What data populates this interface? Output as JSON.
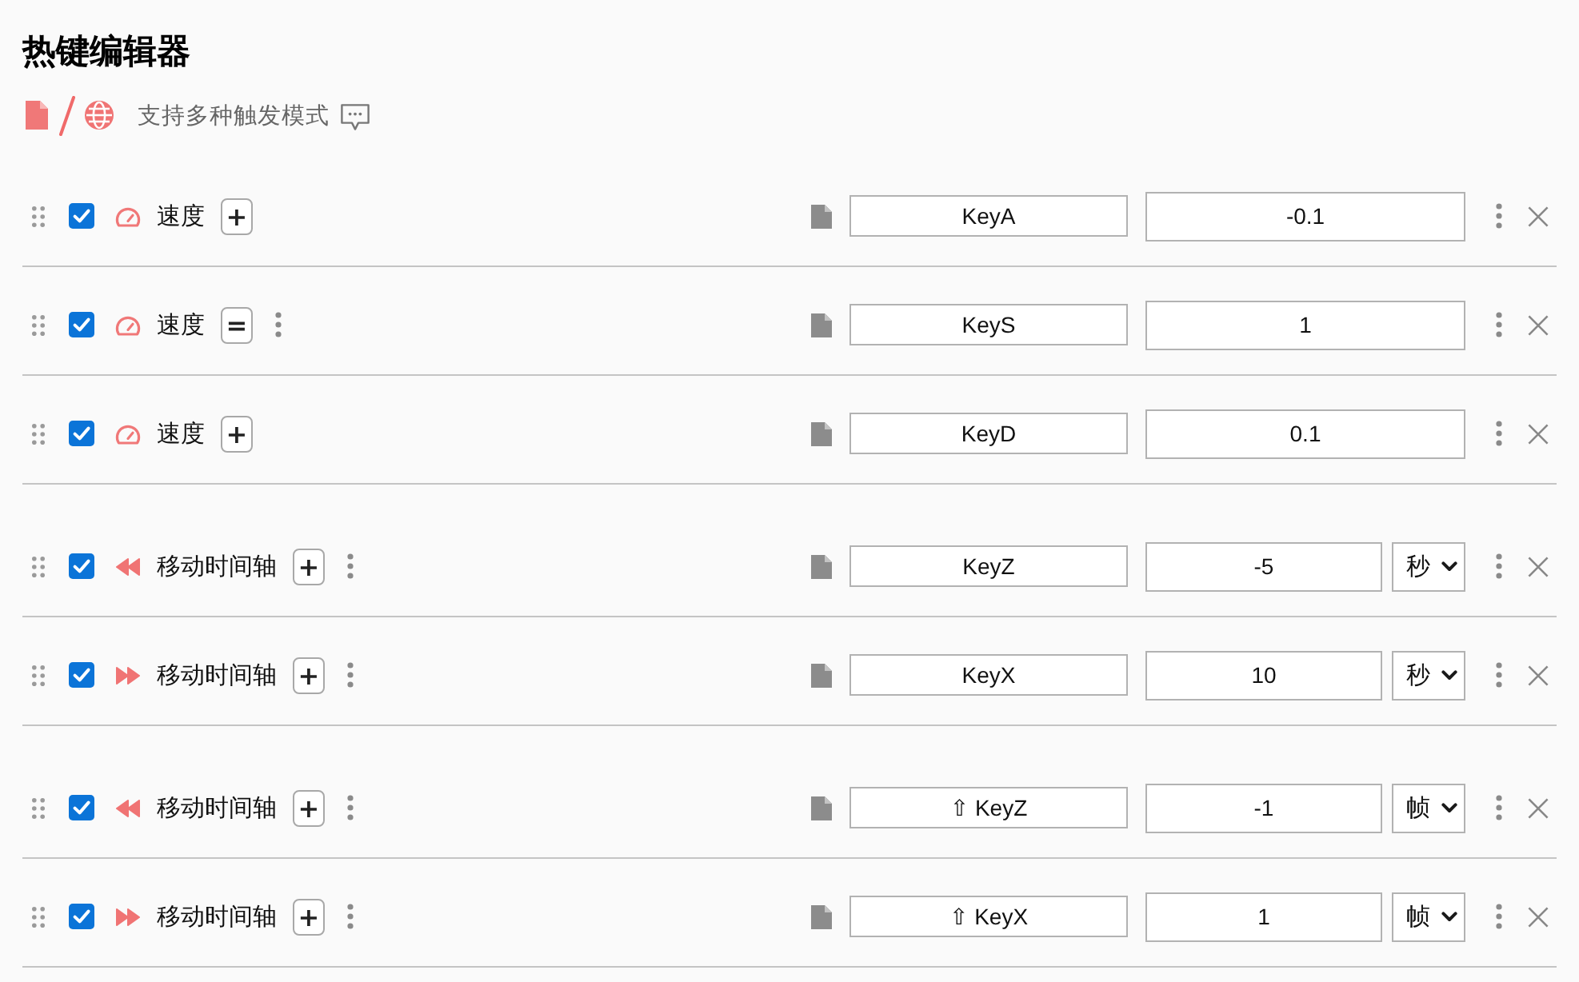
{
  "title": "热键编辑器",
  "subtitle": {
    "text": "支持多种触发模式"
  },
  "groups": [
    {
      "rows": [
        {
          "checked": true,
          "kind": "speed",
          "label": "速度",
          "operator": "+",
          "options_menu": false,
          "key": "KeyA",
          "value": "-0.1"
        },
        {
          "checked": true,
          "kind": "speed",
          "label": "速度",
          "operator": "=",
          "options_menu": true,
          "key": "KeyS",
          "value": "1"
        },
        {
          "checked": true,
          "kind": "speed",
          "label": "速度",
          "operator": "+",
          "options_menu": false,
          "key": "KeyD",
          "value": "0.1"
        }
      ]
    },
    {
      "rows": [
        {
          "checked": true,
          "kind": "seek_backward",
          "label": "移动时间轴",
          "operator": "+",
          "options_menu": true,
          "key": "KeyZ",
          "value": "-5",
          "unit": "秒"
        },
        {
          "checked": true,
          "kind": "seek_forward",
          "label": "移动时间轴",
          "operator": "+",
          "options_menu": true,
          "key": "KeyX",
          "value": "10",
          "unit": "秒"
        }
      ]
    },
    {
      "rows": [
        {
          "checked": true,
          "kind": "seek_backward",
          "label": "移动时间轴",
          "operator": "+",
          "options_menu": true,
          "key": "⇧ KeyZ",
          "value": "-1",
          "unit": "帧"
        },
        {
          "checked": true,
          "kind": "seek_forward",
          "label": "移动时间轴",
          "operator": "+",
          "options_menu": true,
          "key": "⇧ KeyX",
          "value": "1",
          "unit": "帧"
        }
      ]
    }
  ]
}
